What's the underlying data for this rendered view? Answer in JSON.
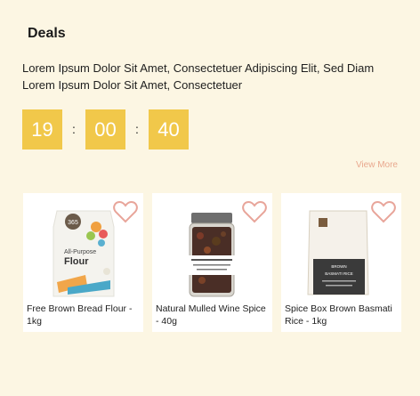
{
  "deals": {
    "title": "Deals",
    "description": "Lorem Ipsum Dolor Sit Amet, Consectetuer Adipiscing Elit, Sed Diam Lorem Ipsum Dolor Sit Amet, Consectetuer",
    "timer": {
      "hours": "19",
      "minutes": "00",
      "seconds": "40",
      "separator": ":"
    },
    "view_more_label": "View More",
    "accent_color": "#f1c84a",
    "heart_color": "#e8a59a",
    "products": [
      {
        "name": "Free Brown Bread Flour - 1kg",
        "icon": "flour-bag-icon",
        "brand": "365",
        "label_line1": "All-Purpose",
        "label_line2": "Flour"
      },
      {
        "name": "Natural Mulled Wine Spice - 40g",
        "icon": "spice-jar-icon"
      },
      {
        "name": "Spice Box Brown Basmati Rice - 1kg",
        "icon": "rice-pouch-icon",
        "label_line1": "BROWN",
        "label_line2": "BASMATI RICE"
      }
    ]
  }
}
